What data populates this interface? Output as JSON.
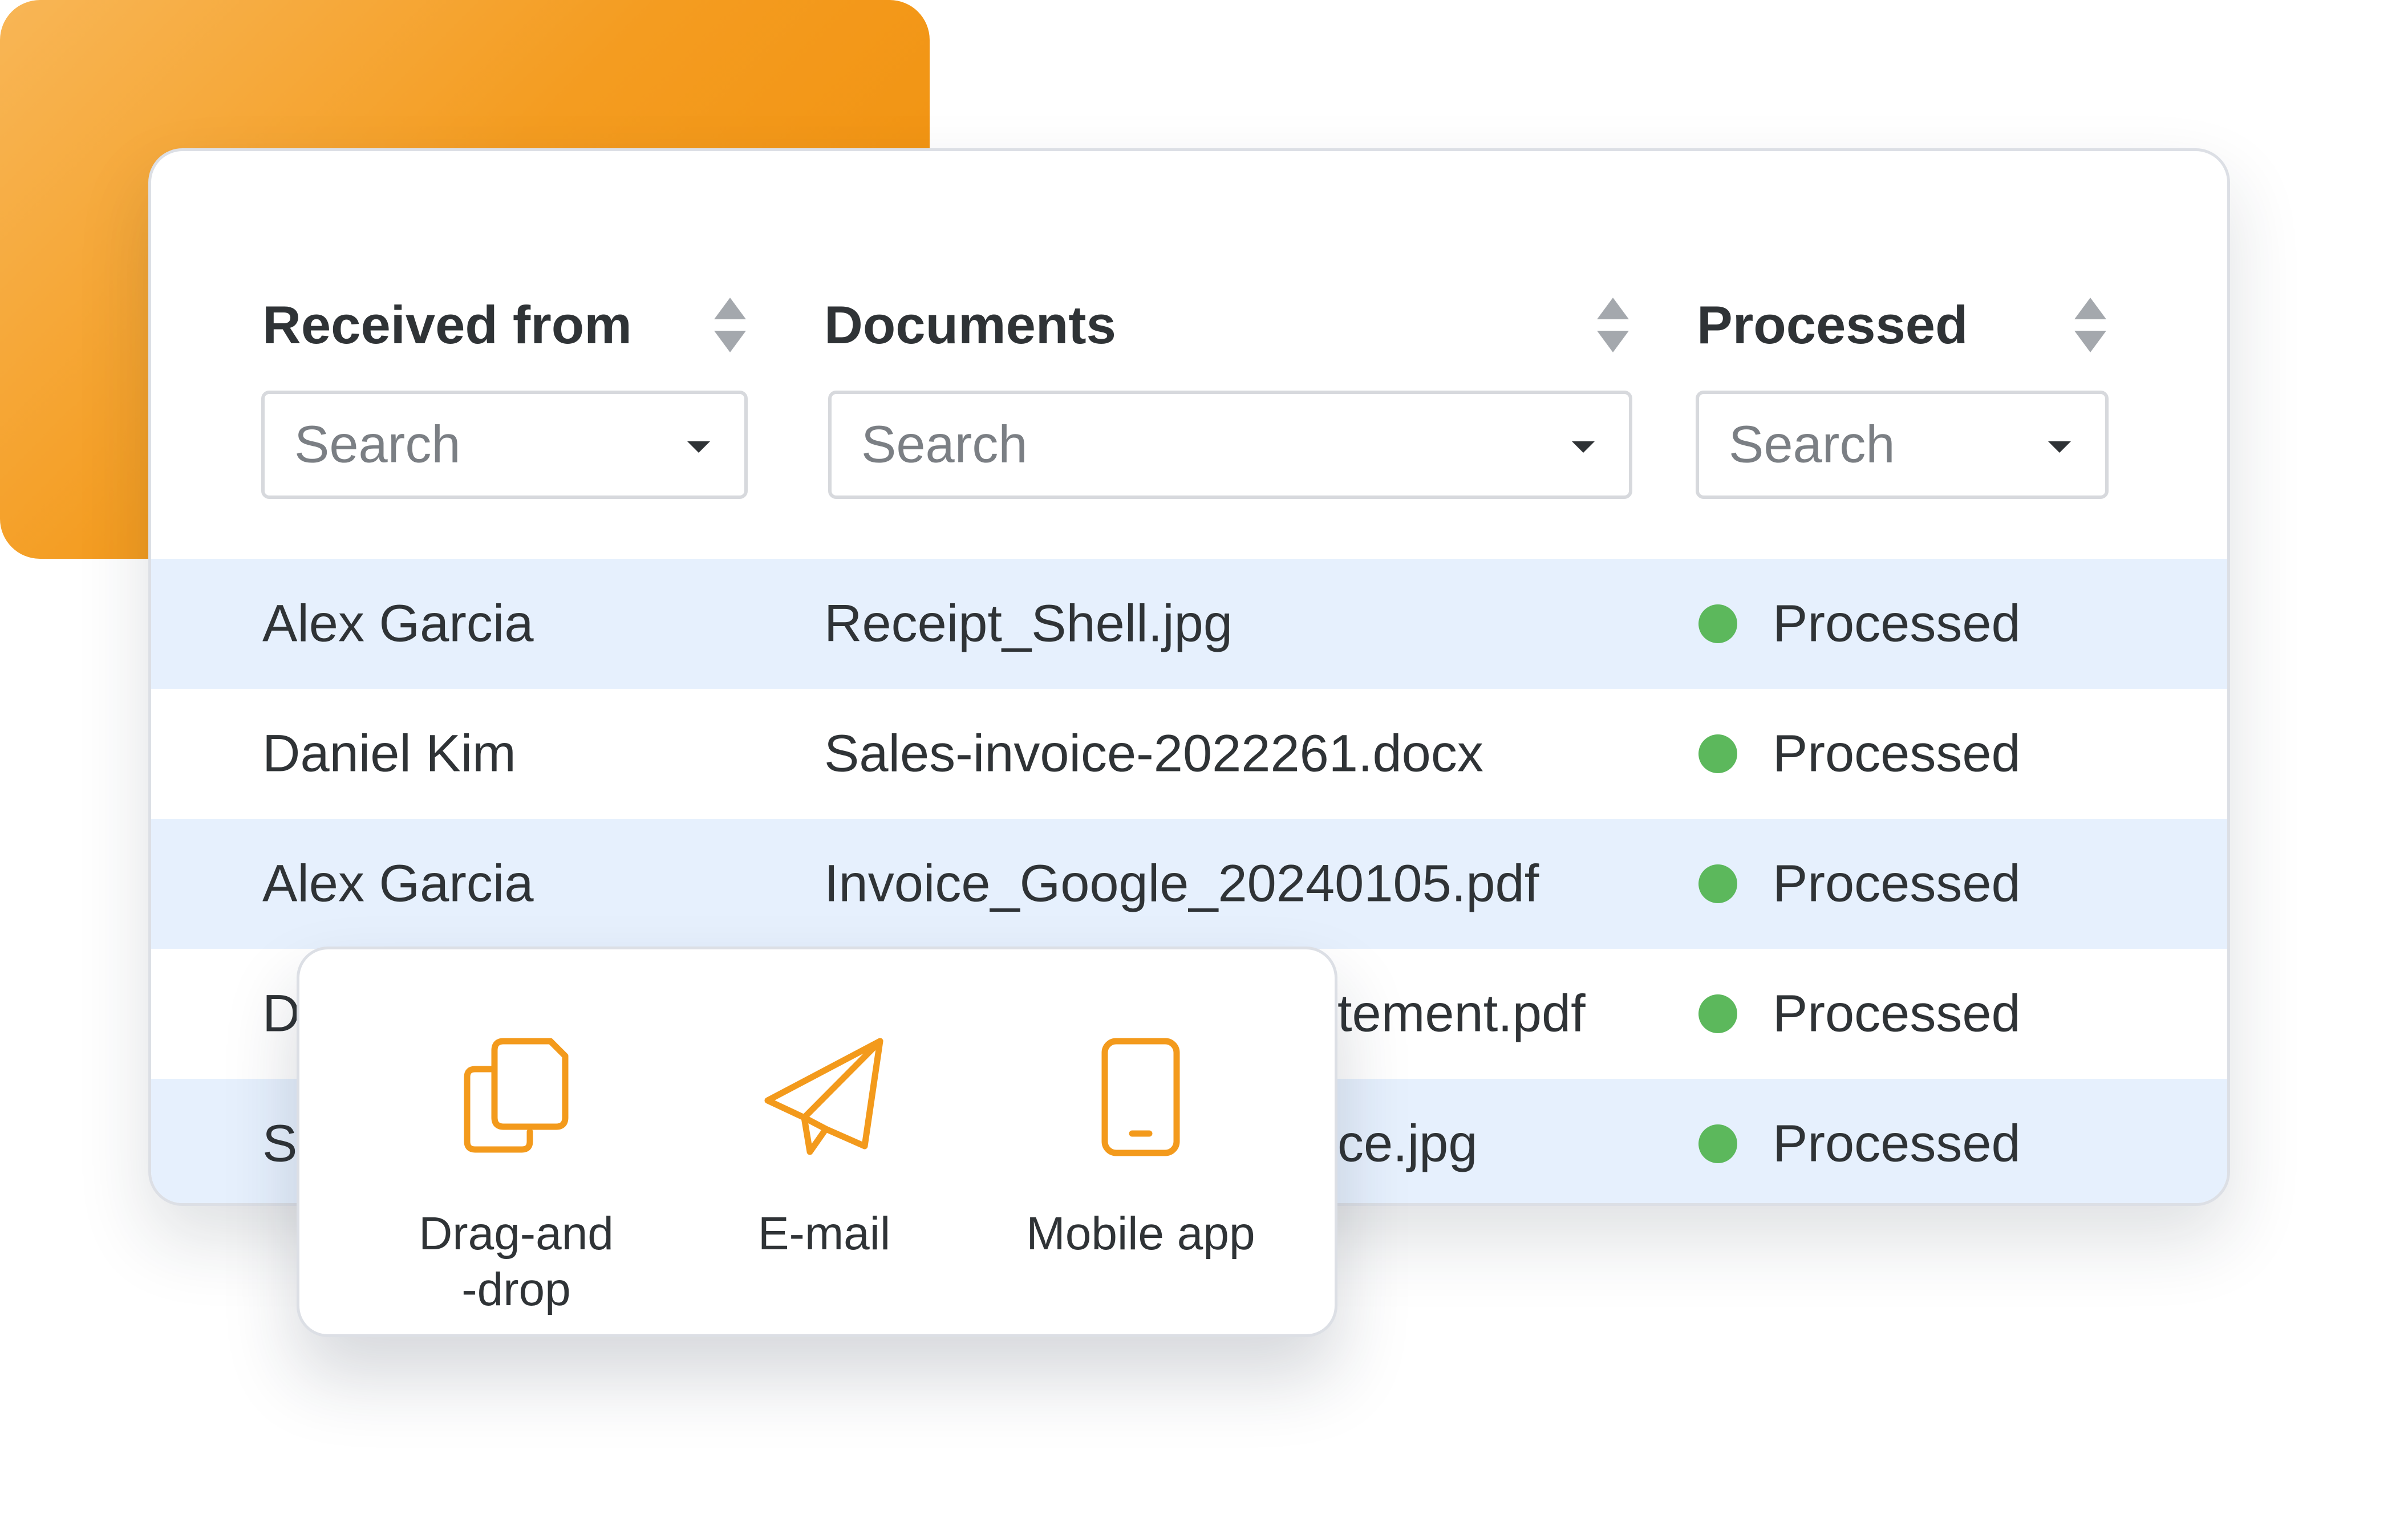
{
  "table": {
    "columns": [
      {
        "label": "Received from",
        "search_placeholder": "Search"
      },
      {
        "label": "Documents",
        "search_placeholder": "Search"
      },
      {
        "label": "Processed",
        "search_placeholder": "Search"
      }
    ],
    "rows": [
      {
        "received_from": "Alex Garcia",
        "document": "Receipt_Shell.jpg",
        "status": "Processed"
      },
      {
        "received_from": "Daniel Kim",
        "document": "Sales-invoice-2022261.docx",
        "status": "Processed"
      },
      {
        "received_from": "Alex Garcia",
        "document": "Invoice_Google_20240105.pdf",
        "status": "Processed"
      },
      {
        "received_from": "D",
        "document": "tement.pdf",
        "status": "Processed"
      },
      {
        "received_from": "S",
        "document": "ce.jpg",
        "status": "Processed"
      }
    ],
    "status_color": "#5cb85c",
    "alt_row_color": "#e6f0fd"
  },
  "upload_options": [
    {
      "label": "Drag-and\n-drop",
      "icon": "copy-documents-icon"
    },
    {
      "label": "E-mail",
      "icon": "paper-plane-icon"
    },
    {
      "label": "Mobile app",
      "icon": "mobile-phone-icon"
    }
  ],
  "colors": {
    "accent": "#f39a1c",
    "text": "#2f3336"
  }
}
